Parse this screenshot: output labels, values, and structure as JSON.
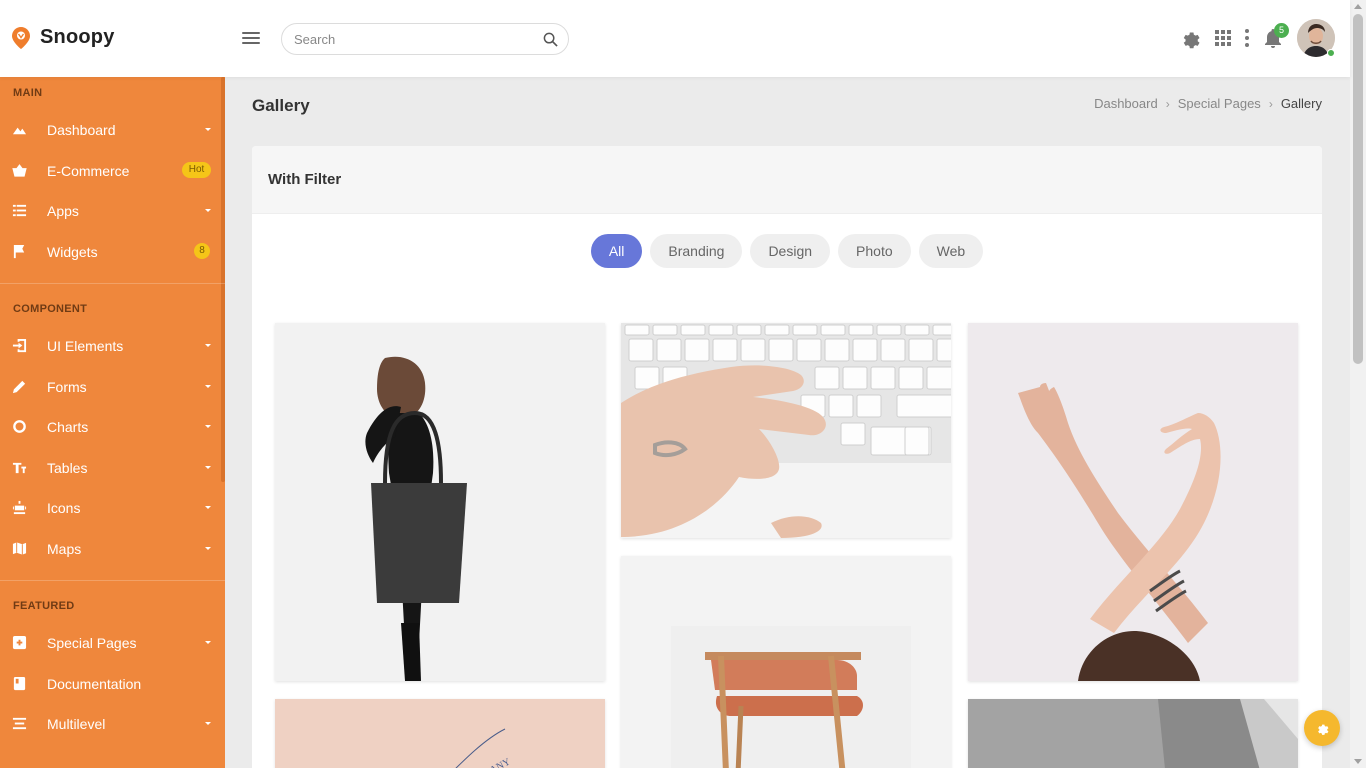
{
  "app": {
    "name": "Snoopy"
  },
  "header": {
    "search_placeholder": "Search",
    "notifications_count": "5",
    "icons": [
      "gear-icon",
      "apps-grid-icon",
      "more-vertical-icon",
      "bell-icon"
    ]
  },
  "sidebar": {
    "sections": [
      {
        "title": "MAIN"
      },
      {
        "title": "COMPONENT"
      },
      {
        "title": "FEATURED"
      }
    ],
    "items": [
      {
        "label": "Dashboard",
        "icon": "dashboard-icon",
        "caret": true
      },
      {
        "label": "E-Commerce",
        "icon": "basket-icon",
        "badge": "Hot"
      },
      {
        "label": "Apps",
        "icon": "apps-list-icon",
        "caret": true
      },
      {
        "label": "Widgets",
        "icon": "flag-icon",
        "badge": "8"
      },
      {
        "label": "UI Elements",
        "icon": "ui-elements-icon",
        "caret": true
      },
      {
        "label": "Forms",
        "icon": "pencil-icon",
        "caret": true
      },
      {
        "label": "Charts",
        "icon": "donut-chart-icon",
        "caret": true
      },
      {
        "label": "Tables",
        "icon": "tables-icon",
        "caret": true
      },
      {
        "label": "Icons",
        "icon": "icons-icon",
        "caret": true
      },
      {
        "label": "Maps",
        "icon": "map-icon",
        "caret": true
      },
      {
        "label": "Special Pages",
        "icon": "special-pages-icon",
        "caret": true
      },
      {
        "label": "Documentation",
        "icon": "book-icon"
      },
      {
        "label": "Multilevel",
        "icon": "multilevel-icon",
        "caret": true
      }
    ],
    "colors": {
      "background": "#ef873c",
      "badge": "#f5c518"
    }
  },
  "page": {
    "title": "Gallery",
    "breadcrumb": [
      "Dashboard",
      "Special Pages",
      "Gallery"
    ]
  },
  "card": {
    "title": "With Filter",
    "filters": [
      "All",
      "Branding",
      "Design",
      "Photo",
      "Web"
    ],
    "active_filter": "All",
    "accent": "#6777d9",
    "gallery": [
      {
        "subject": "woman-with-bag-photo"
      },
      {
        "subject": "hand-on-keyboard-photo"
      },
      {
        "subject": "raised-hands-photo"
      },
      {
        "subject": "wooden-chair-photo"
      },
      {
        "subject": "pink-card-print-photo"
      },
      {
        "subject": "grey-desk-photo"
      }
    ]
  },
  "fab": {
    "icon": "gear-icon",
    "color": "#f5b82e"
  }
}
